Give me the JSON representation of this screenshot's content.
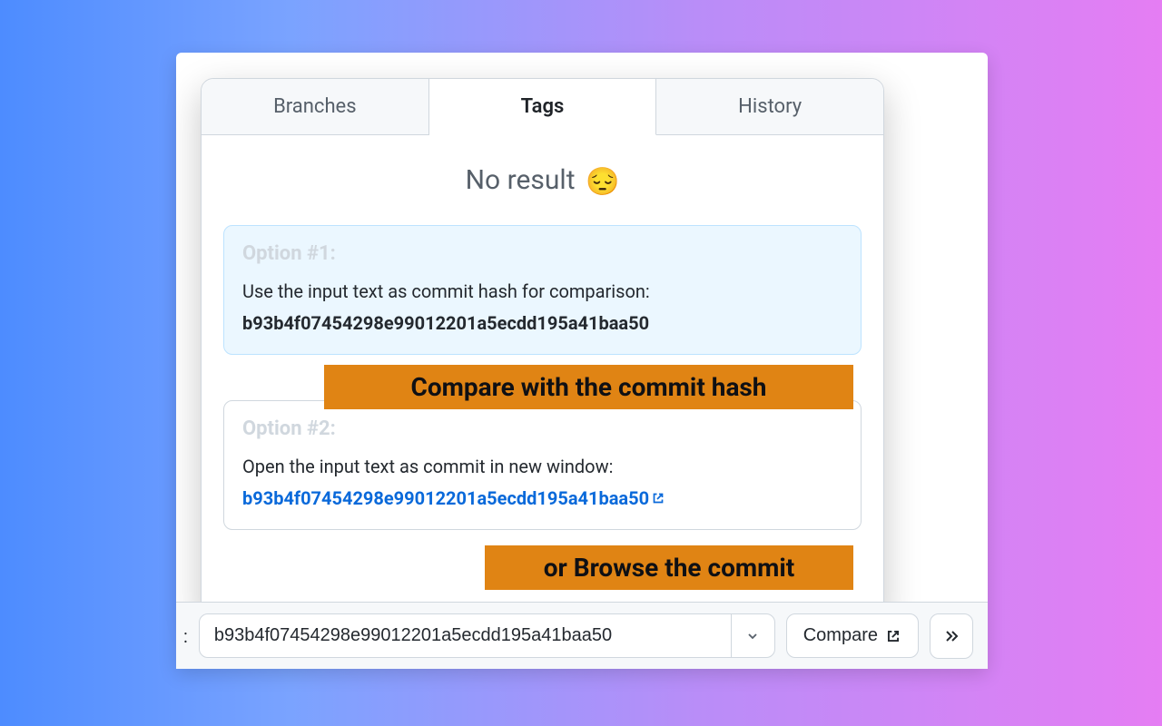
{
  "tabs": {
    "branches": "Branches",
    "tags": "Tags",
    "history": "History"
  },
  "noresult": {
    "text": "No result",
    "emoji": "😔"
  },
  "option1": {
    "title": "Option #1:",
    "text": "Use the input text as commit hash for comparison:",
    "hash": "b93b4f07454298e99012201a5ecdd195a41baa50"
  },
  "option2": {
    "title": "Option #2:",
    "text": "Open the input text as commit in new window:",
    "hash": "b93b4f07454298e99012201a5ecdd195a41baa50"
  },
  "callouts": {
    "c1": "Compare with  the commit hash",
    "c2": "or Browse the commit"
  },
  "bottom": {
    "leading": ":",
    "input_value": "b93b4f07454298e99012201a5ecdd195a41baa50",
    "compare_label": "Compare"
  }
}
